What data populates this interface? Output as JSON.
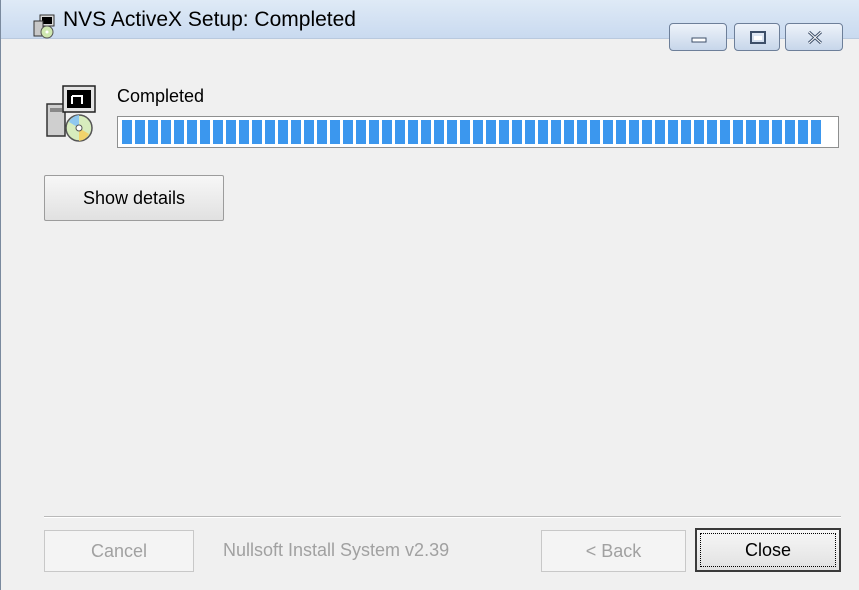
{
  "window": {
    "title": "NVS ActiveX Setup: Completed",
    "title_icon": "installer-icon",
    "controls": [
      "minimize-icon",
      "maximize-icon",
      "close-icon"
    ]
  },
  "main": {
    "header_icon": "setup-package-icon",
    "status_label": "Completed",
    "progress": {
      "value_percent": 100,
      "color": "#3b97ee"
    },
    "show_details_label": "Show details"
  },
  "footer": {
    "cancel_label": "Cancel",
    "branding": "Nullsoft Install System v2.39",
    "back_label": "< Back",
    "close_label": "Close"
  },
  "colors": {
    "titlebar": "#c9daf0",
    "window_bg": "#f0f0f0",
    "disabled_text": "#a1a1a1"
  }
}
